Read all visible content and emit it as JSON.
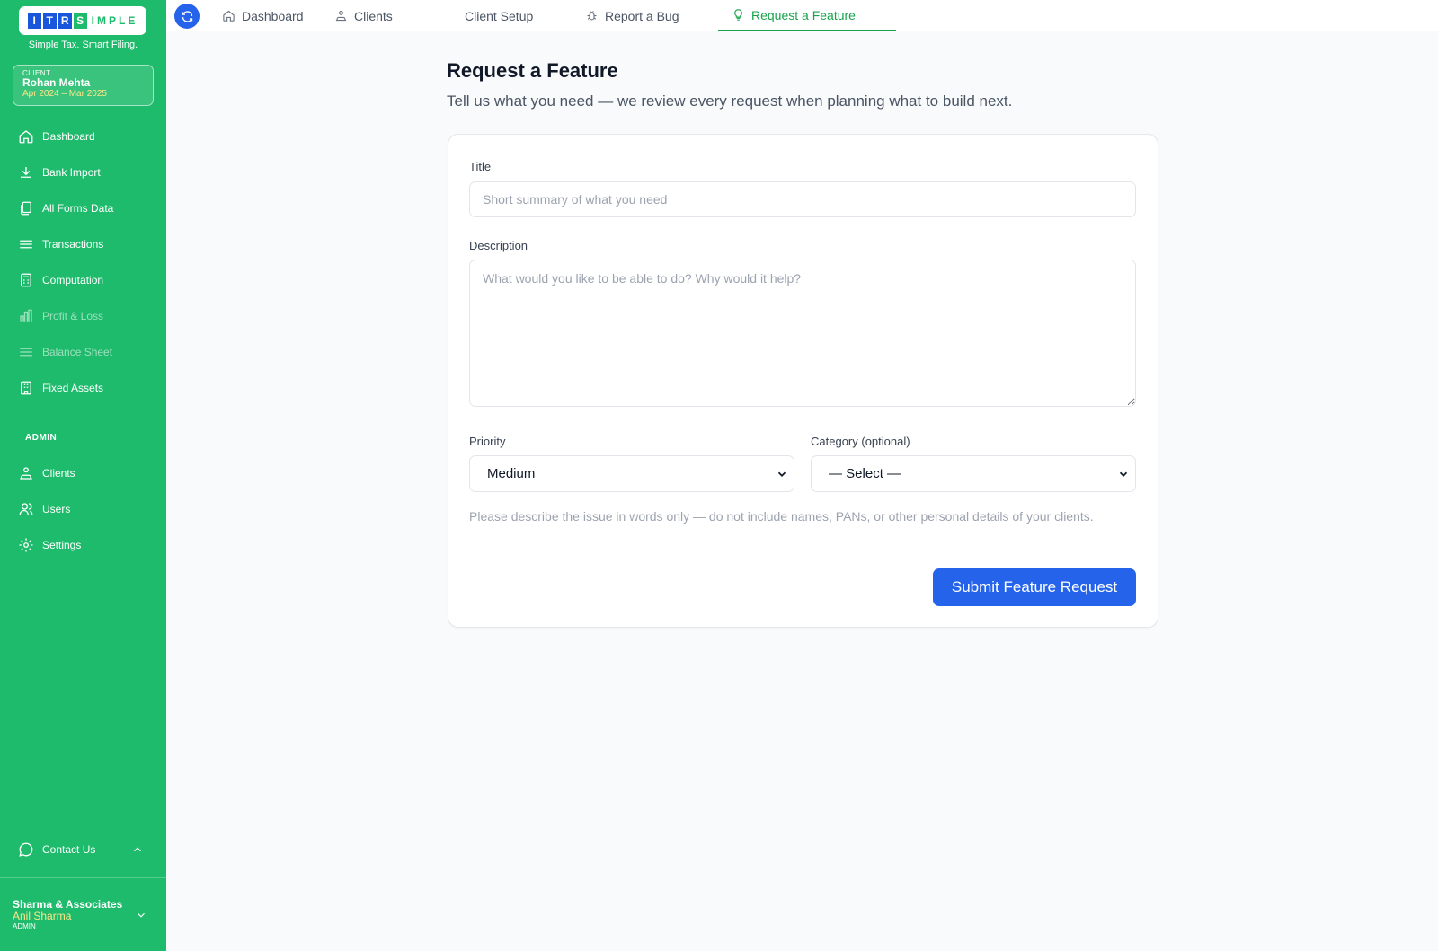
{
  "brand": {
    "logo_letters": [
      "I",
      "T",
      "R",
      "S"
    ],
    "logo_rest": "IMPLE",
    "tagline": "Simple Tax. Smart Filing."
  },
  "client": {
    "label": "CLIENT",
    "name": "Rohan Mehta",
    "period": "Apr 2024 – Mar 2025"
  },
  "sidebar": {
    "items": [
      {
        "label": "Dashboard",
        "icon": "home-icon"
      },
      {
        "label": "Bank Import",
        "icon": "download-icon"
      },
      {
        "label": "All Forms Data",
        "icon": "documents-icon"
      },
      {
        "label": "Transactions",
        "icon": "list-icon"
      },
      {
        "label": "Computation",
        "icon": "calculator-icon"
      },
      {
        "label": "Profit & Loss",
        "icon": "bar-chart-icon"
      },
      {
        "label": "Balance Sheet",
        "icon": "list-icon"
      },
      {
        "label": "Fixed Assets",
        "icon": "building-icon"
      }
    ],
    "admin_label": "ADMIN",
    "admin_items": [
      {
        "label": "Clients",
        "icon": "users-tree-icon"
      },
      {
        "label": "Users",
        "icon": "users-icon"
      },
      {
        "label": "Settings",
        "icon": "gear-icon"
      }
    ],
    "contact": "Contact Us",
    "firm": {
      "org": "Sharma & Associates",
      "user": "Anil Sharma",
      "role": "ADMIN"
    }
  },
  "tabs": [
    {
      "label": "Dashboard",
      "icon": "home-icon"
    },
    {
      "label": "Clients",
      "icon": "users-tree-icon"
    },
    {
      "label": "Client Setup",
      "icon": ""
    },
    {
      "label": "Report a Bug",
      "icon": "bug-icon"
    },
    {
      "label": "Request a Feature",
      "icon": "lightbulb-icon",
      "active": true
    }
  ],
  "page": {
    "title": "Request a Feature",
    "subtitle": "Tell us what you need — we review every request when planning what to build next."
  },
  "form": {
    "title_label": "Title",
    "title_placeholder": "Short summary of what you need",
    "description_label": "Description",
    "description_placeholder": "What would you like to be able to do? Why would it help?",
    "priority_label": "Priority",
    "priority_value": "Medium",
    "category_label": "Category (optional)",
    "category_value": "— Select —",
    "note": "Please describe the issue in words only — do not include names, PANs, or other personal details of your clients.",
    "submit_label": "Submit Feature Request"
  },
  "colors": {
    "sidebar_green": "#1fbb6c",
    "accent_blue": "#2563eb",
    "active_tab_green": "#16a34a"
  }
}
